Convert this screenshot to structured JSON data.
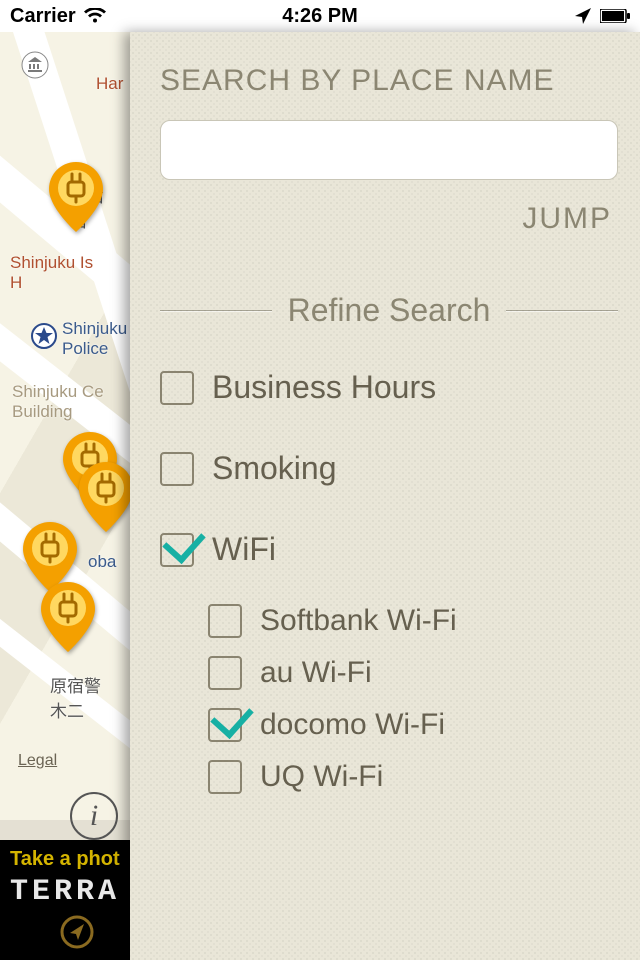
{
  "status_bar": {
    "carrier": "Carrier",
    "time": "4:26 PM"
  },
  "map": {
    "labels": {
      "har": "Har",
      "shinjuku_hotel": "Shinjuku Is\nH",
      "shinjuku_police": "Shinjuku\nPolice",
      "shinjuku_ctr": "Shinjuku Ce\nBuilding",
      "oba": "oba",
      "harajuku_jp": "原宿警\n木二",
      "shinjuku_top": "新宿\n宿",
      "legal": "Legal"
    },
    "info_button": "i",
    "ad": {
      "line1": "Take a phot",
      "line2": "TERRA"
    }
  },
  "search": {
    "title": "SEARCH BY PLACE NAME",
    "value": "",
    "placeholder": "",
    "jump_label": "JUMP"
  },
  "refine": {
    "header": "Refine Search",
    "items": [
      {
        "label": "Business Hours",
        "checked": false
      },
      {
        "label": "Smoking",
        "checked": false
      },
      {
        "label": "WiFi",
        "checked": true,
        "children": [
          {
            "label": "Softbank Wi-Fi",
            "checked": false
          },
          {
            "label": "au Wi-Fi",
            "checked": false
          },
          {
            "label": "docomo Wi-Fi",
            "checked": true
          },
          {
            "label": "UQ Wi-Fi",
            "checked": false
          }
        ]
      }
    ]
  }
}
